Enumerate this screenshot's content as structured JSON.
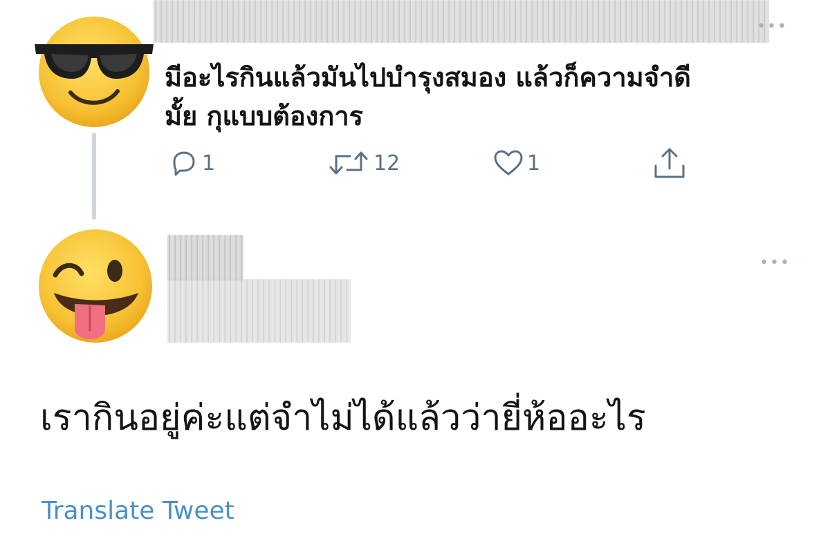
{
  "parent_tweet": {
    "avatar_icon": "sunglasses-emoji-icon",
    "text_lines": [
      "มีอะไรกินแล้วมันไปบำรุงสมอง แล้วก็ความจำดี",
      "มั้ย กุแบบต้องการ"
    ],
    "more_icon": "ellipsis-icon",
    "more_label": "•••",
    "actions": {
      "reply": {
        "icon": "reply-icon",
        "count": "1"
      },
      "retweet": {
        "icon": "retweet-icon",
        "count": "12"
      },
      "like": {
        "icon": "heart-icon",
        "count": "1"
      },
      "share": {
        "icon": "share-icon"
      }
    }
  },
  "reply_tweet": {
    "avatar_icon": "winking-tongue-emoji-icon",
    "more_icon": "ellipsis-icon",
    "more_label": "•••",
    "text": "เรากินอยู่ค่ะแต่จำไม่ได้แล้วว่ายี่ห้ออะไร",
    "translate_label": "Translate Tweet"
  },
  "colors": {
    "action_gray": "#5b7083",
    "link_blue": "#4a90c9",
    "thread_line": "#cfd6db",
    "emoji_yellow": "#f7c234"
  }
}
